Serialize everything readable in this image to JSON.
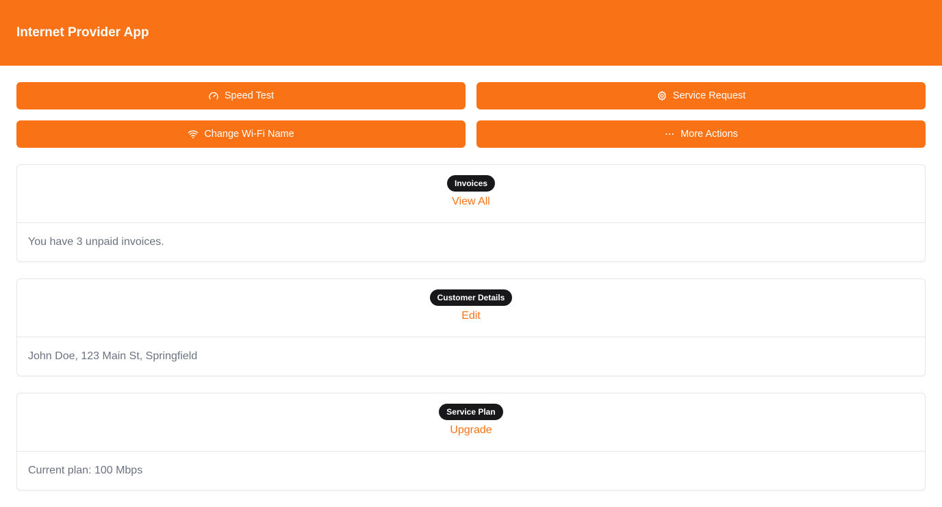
{
  "header": {
    "title": "Internet Provider App"
  },
  "actions": [
    {
      "label": "Speed Test",
      "icon": "gauge-icon"
    },
    {
      "label": "Service Request",
      "icon": "gear-icon"
    },
    {
      "label": "Change Wi-Fi Name",
      "icon": "wifi-icon"
    },
    {
      "label": "More Actions",
      "icon": "ellipsis-icon"
    }
  ],
  "cards": [
    {
      "badge": "Invoices",
      "link": "View All",
      "body": "You have 3 unpaid invoices."
    },
    {
      "badge": "Customer Details",
      "link": "Edit",
      "body": "John Doe, 123 Main St, Springfield"
    },
    {
      "badge": "Service Plan",
      "link": "Upgrade",
      "body": "Current plan: 100 Mbps"
    }
  ],
  "colors": {
    "accent": "#f97316",
    "badge_bg": "#18181b",
    "body_text": "#6b7280",
    "border": "#e5e7eb"
  }
}
